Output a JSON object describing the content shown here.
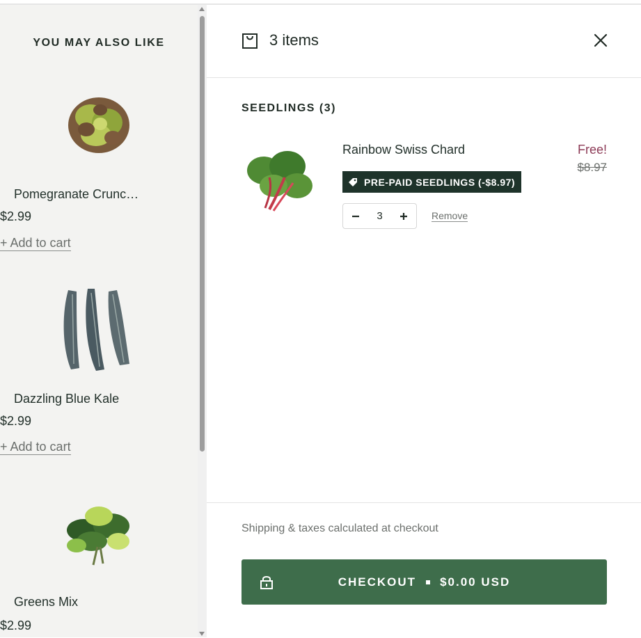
{
  "recommendations": {
    "title": "YOU MAY ALSO LIKE",
    "items": [
      {
        "name": "Pomegranate Crunc…",
        "price": "$2.99",
        "add_label": "+ Add to cart"
      },
      {
        "name": "Dazzling Blue Kale",
        "price": "$2.99",
        "add_label": "+ Add to cart"
      },
      {
        "name": "Greens Mix",
        "price": "$2.99"
      }
    ]
  },
  "cart": {
    "items_count": "3 items",
    "section_title": "SEEDLINGS (3)",
    "item": {
      "name": "Rainbow Swiss Chard",
      "price_now": "Free!",
      "price_original": "$8.97",
      "discount": "PRE-PAID SEEDLINGS (-$8.97)",
      "quantity": "3",
      "remove_label": "Remove"
    },
    "shipping_note": "Shipping & taxes calculated at checkout",
    "checkout": {
      "label": "CHECKOUT",
      "amount": "$0.00 USD"
    }
  },
  "colors": {
    "accent": "#3e6d4b",
    "badge": "#1e332a",
    "free_price": "#8c3a56",
    "panel_bg": "#f3f3f1"
  },
  "icons": [
    "bag-icon",
    "close-icon",
    "tag-icon",
    "minus-icon",
    "plus-icon",
    "lock-icon"
  ]
}
